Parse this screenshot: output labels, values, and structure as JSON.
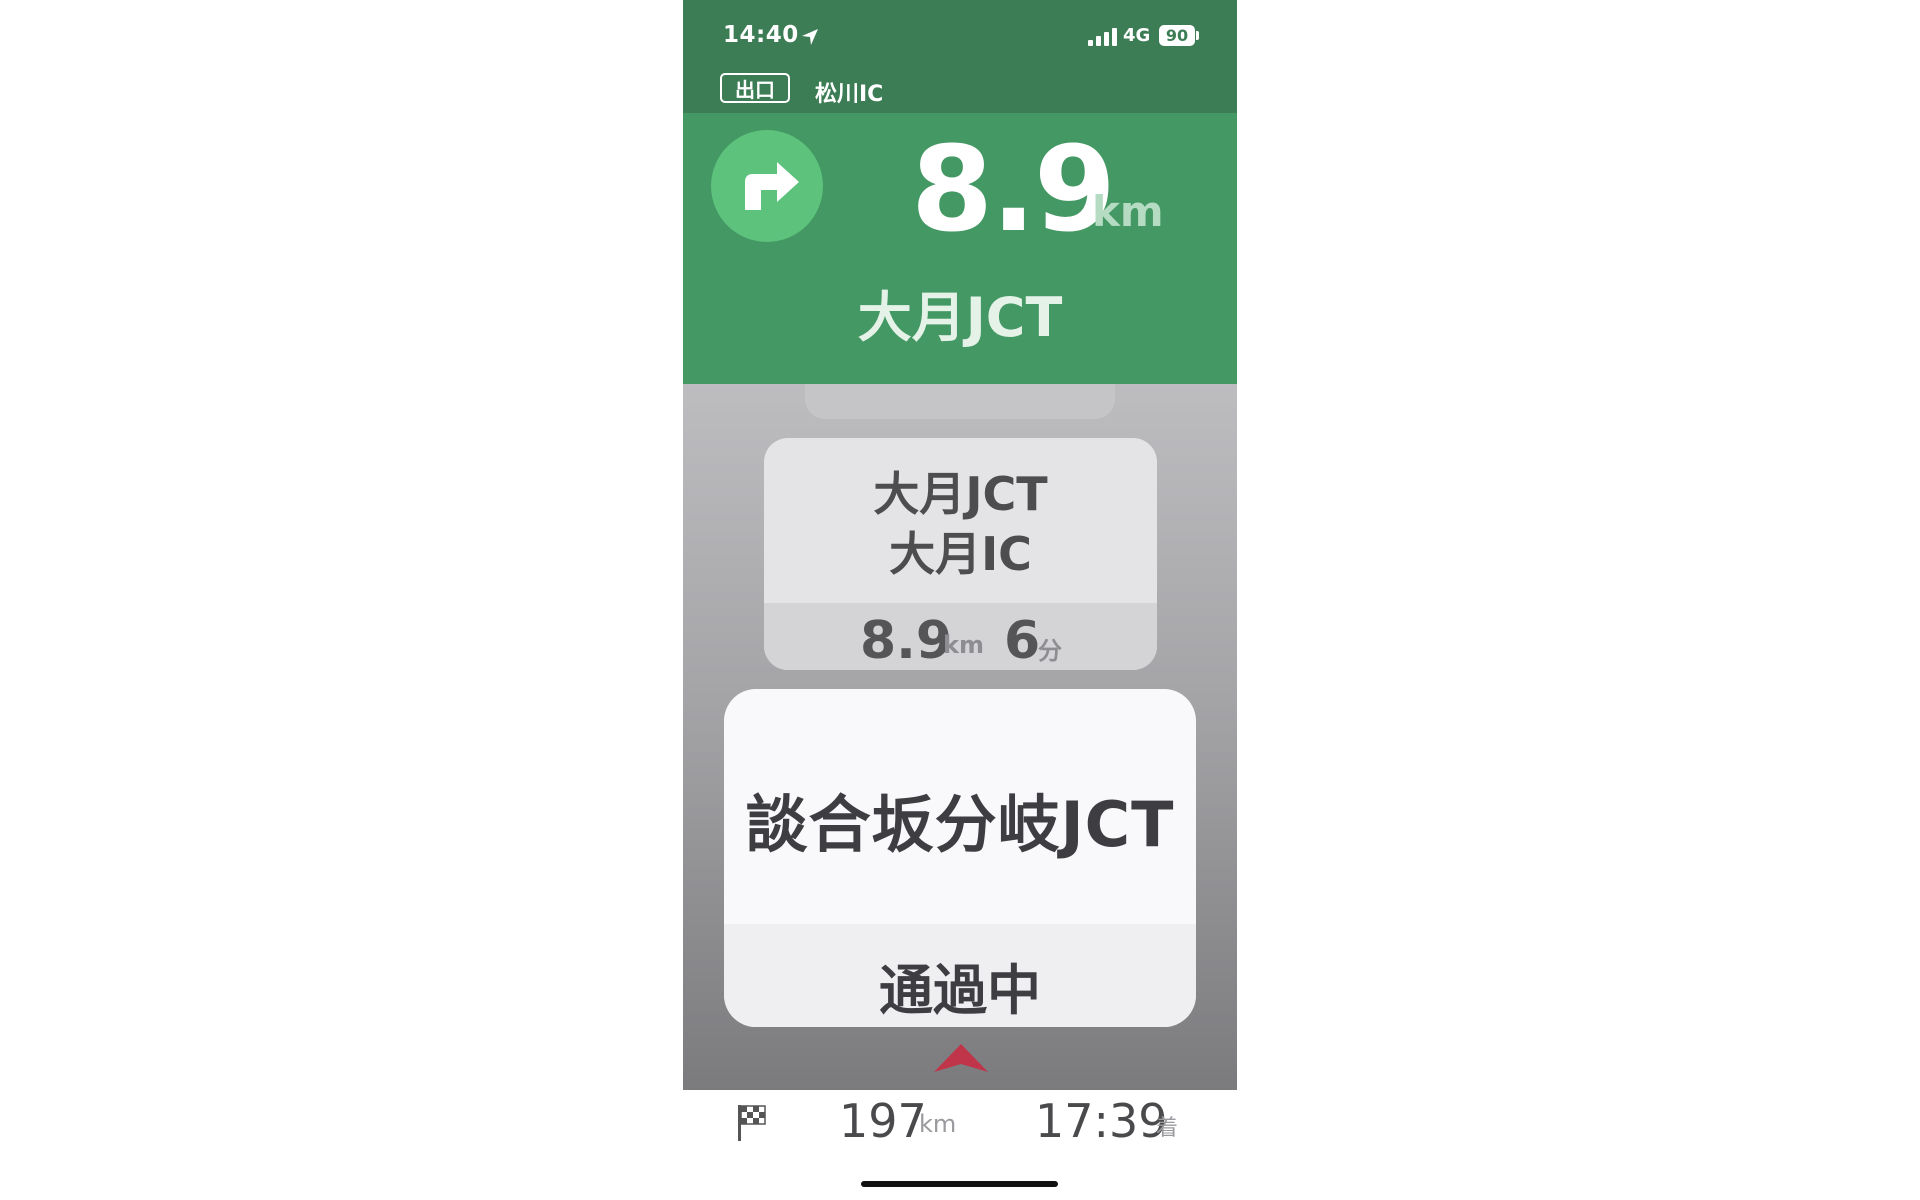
{
  "status_bar": {
    "time": "14:40",
    "network": "4G",
    "battery": "90",
    "icons": [
      "location-arrow-icon",
      "signal-icon",
      "battery-icon"
    ]
  },
  "exit_bar": {
    "badge": "出口",
    "name": "松川IC"
  },
  "banner": {
    "turn_icon": "turn-right-icon",
    "distance": "8.9",
    "distance_unit": "km",
    "name": "大月JCT",
    "colors": {
      "top": "#3d7d55",
      "main": "#439863",
      "icon_circle": "#5cc27c"
    }
  },
  "upcoming": {
    "line1": "大月JCT",
    "line2": "大月IC",
    "distance": "8.9",
    "distance_unit": "km",
    "time": "6",
    "time_unit": "分"
  },
  "current": {
    "name": "談合坂分岐JCT",
    "status": "通過中"
  },
  "marker": {
    "icon": "car-position-icon",
    "color": "#c0354a"
  },
  "bottom": {
    "flag_icon": "checkered-flag-icon",
    "remaining_distance": "197",
    "remaining_unit": "km",
    "arrival_time": "17:39",
    "arrival_suffix": "着"
  }
}
